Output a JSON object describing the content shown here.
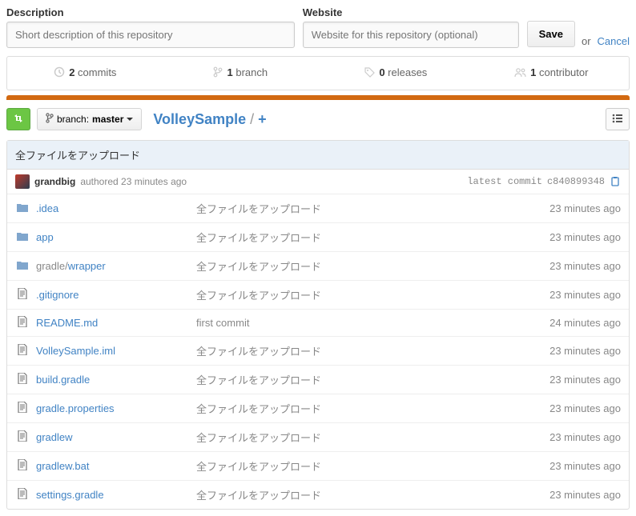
{
  "desc": {
    "label": "Description",
    "placeholder": "Short description of this repository"
  },
  "website": {
    "label": "Website",
    "placeholder": "Website for this repository (optional)"
  },
  "save_label": "Save",
  "or_label": "or",
  "cancel_label": "Cancel",
  "stats": {
    "commits_n": "2",
    "commits_l": "commits",
    "branches_n": "1",
    "branches_l": "branch",
    "releases_n": "0",
    "releases_l": "releases",
    "contrib_n": "1",
    "contrib_l": "contributor"
  },
  "branch_label": "branch:",
  "branch_name": "master",
  "repo_name": "VolleySample",
  "slash": " / ",
  "plus": "+",
  "commit_message": "全ファイルをアップロード",
  "author": "grandbig",
  "authored_text": "authored 23 minutes ago",
  "latest_commit_label": "latest commit",
  "commit_hash": "c840899348",
  "files": [
    {
      "type": "folder",
      "name": ".idea",
      "msg": "全ファイルをアップロード",
      "time": "23 minutes ago"
    },
    {
      "type": "folder",
      "name": "app",
      "msg": "全ファイルをアップロード",
      "time": "23 minutes ago"
    },
    {
      "type": "folder",
      "name": "gradle/wrapper",
      "msg": "全ファイルをアップロード",
      "time": "23 minutes ago"
    },
    {
      "type": "file",
      "name": ".gitignore",
      "msg": "全ファイルをアップロード",
      "time": "23 minutes ago"
    },
    {
      "type": "file",
      "name": "README.md",
      "msg": "first commit",
      "time": "24 minutes ago"
    },
    {
      "type": "file",
      "name": "VolleySample.iml",
      "msg": "全ファイルをアップロード",
      "time": "23 minutes ago"
    },
    {
      "type": "file",
      "name": "build.gradle",
      "msg": "全ファイルをアップロード",
      "time": "23 minutes ago"
    },
    {
      "type": "file",
      "name": "gradle.properties",
      "msg": "全ファイルをアップロード",
      "time": "23 minutes ago"
    },
    {
      "type": "file",
      "name": "gradlew",
      "msg": "全ファイルをアップロード",
      "time": "23 minutes ago"
    },
    {
      "type": "file",
      "name": "gradlew.bat",
      "msg": "全ファイルをアップロード",
      "time": "23 minutes ago"
    },
    {
      "type": "file",
      "name": "settings.gradle",
      "msg": "全ファイルをアップロード",
      "time": "23 minutes ago"
    }
  ]
}
